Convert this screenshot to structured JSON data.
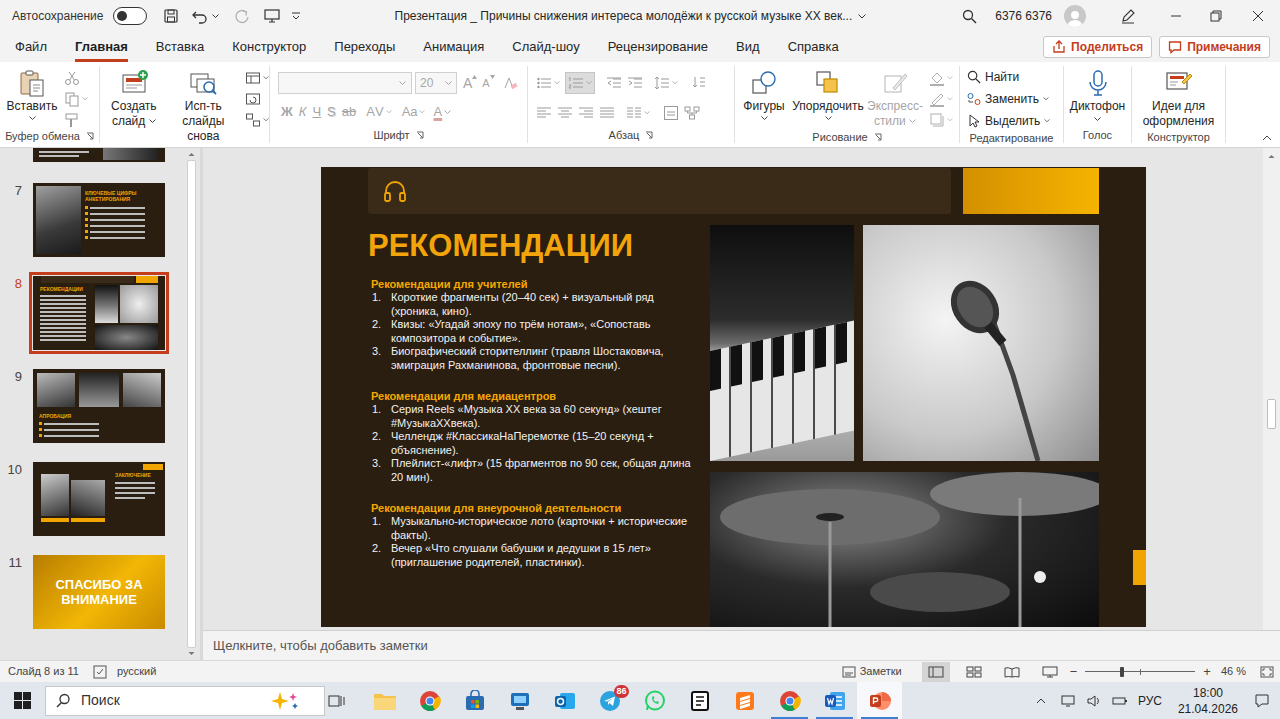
{
  "window": {
    "autosave": {
      "label": "Автосохранение",
      "on": false
    },
    "title": "Презентация _ Причины снижения интереса молодёжи к русской музыке XX век...",
    "user": "6376 6376"
  },
  "tabs": [
    {
      "label": "Файл",
      "selected": false
    },
    {
      "label": "Главная",
      "selected": true
    },
    {
      "label": "Вставка",
      "selected": false
    },
    {
      "label": "Конструктор",
      "selected": false
    },
    {
      "label": "Переходы",
      "selected": false
    },
    {
      "label": "Анимация",
      "selected": false
    },
    {
      "label": "Слайд-шоу",
      "selected": false
    },
    {
      "label": "Рецензирование",
      "selected": false
    },
    {
      "label": "Вид",
      "selected": false
    },
    {
      "label": "Справка",
      "selected": false
    }
  ],
  "share": {
    "label": "Поделиться"
  },
  "comments": {
    "label": "Примечания"
  },
  "ribbon": {
    "clipboard": {
      "label": "Буфер обмена",
      "paste": "Вставить"
    },
    "slides": {
      "label": "Слайды",
      "new_slide": "Создать слайд",
      "reuse": "Исп-ть слайды снова"
    },
    "font": {
      "label": "Шрифт",
      "disabled": true,
      "size": "20",
      "size_buttons": [
        "A",
        "A"
      ],
      "buttons": [
        {
          "label": "Ж",
          "kind": "bold"
        },
        {
          "label": "К",
          "kind": "italic"
        },
        {
          "label": "Ч",
          "kind": "underline"
        },
        {
          "label": "S",
          "kind": "shadow"
        },
        {
          "label": "ab",
          "kind": "strike"
        },
        {
          "label": "AV",
          "kind": "spacing"
        },
        {
          "label": "Aa",
          "kind": "case"
        }
      ],
      "color_button": "A"
    },
    "paragraph": {
      "label": "Абзац",
      "disabled": true,
      "numbering": true
    },
    "drawing": {
      "label": "Рисование",
      "shapes": "Фигуры",
      "arrange": "Упорядочить",
      "quick_styles": {
        "label": "Экспресс-стили",
        "disabled": true
      },
      "shape_format": {
        "disabled": true
      }
    },
    "editing": {
      "label": "Редактирование",
      "find": "Найти",
      "replace": "Заменить",
      "select": "Выделить"
    },
    "voice": {
      "label": "Голос",
      "dictate": "Диктофон"
    },
    "designer": {
      "label": "Конструктор",
      "ideas": "Идеи для оформления"
    }
  },
  "thumbnails": [
    {
      "number": "7",
      "kind": "stats",
      "title": "КЛЮЧЕВЫЕ ЦИФРЫ АНКЕТИРОВАНИЯ",
      "selected": false
    },
    {
      "number": "8",
      "kind": "recommend",
      "title": "РЕКОМЕНДАЦИИ",
      "selected": true
    },
    {
      "number": "9",
      "kind": "approbation",
      "title": "АПРОБАЦИЯ",
      "selected": false
    },
    {
      "number": "10",
      "kind": "conclusion",
      "title": "ЗАКЛЮЧЕНИЕ",
      "selected": false
    },
    {
      "number": "11",
      "kind": "thanks",
      "title": "СПАСИБО ЗА ВНИМАНИЕ",
      "selected": false
    }
  ],
  "slide": {
    "title": "РЕКОМЕНДАЦИИ",
    "sections": [
      {
        "heading": "Рекомендации для учителей",
        "items": [
          {
            "n": "1.",
            "text": "Короткие фрагменты (20–40 сек) + визуальный ряд (хроника, кино)."
          },
          {
            "n": "2.",
            "text": "Квизы: «Угадай эпоху по трём нотам», «Сопоставь композитора и событие»."
          },
          {
            "n": "3.",
            "text": "Биографический сторителлинг (травля Шостаковича, эмиграция Рахманинова, фронтовые песни)."
          }
        ]
      },
      {
        "heading": "Рекомендации для медиацентров",
        "items": [
          {
            "n": "1.",
            "text": "Серия Reels «Музыка XX века за 60 секунд» (хештег #МузыкаXXвека)."
          },
          {
            "n": "2.",
            "text": "Челлендж #КлассикаНаПеремотке (15–20 секунд + объяснение)."
          },
          {
            "n": "3.",
            "text": "Плейлист-«лифт» (15 фрагментов по 90 сек, общая длина 20 мин)."
          }
        ]
      },
      {
        "heading": "Рекомендации для внеурочной деятельности",
        "items": [
          {
            "n": "1.",
            "text": "Музыкально-историческое лото (карточки + исторические факты)."
          },
          {
            "n": "2.",
            "text": "Вечер «Что слушали бабушки и дедушки в 15 лет» (приглашение родителей, пластинки)."
          }
        ]
      }
    ]
  },
  "notes": {
    "placeholder": "Щелкните, чтобы добавить заметки"
  },
  "status_bar": {
    "slide": "Слайд 8 из 11",
    "language": "русский",
    "notes": "Заметки",
    "views": [
      {
        "selected": true
      },
      {
        "selected": false
      },
      {
        "selected": false
      },
      {
        "selected": false
      }
    ],
    "minus": "−",
    "plus": "+",
    "zoom_level": 0.33,
    "zoom": "46 %"
  },
  "taskbar": {
    "search": "Поиск",
    "telegram_badge": "86",
    "language": "РУС",
    "time": "18:00",
    "date": "21.04.2026",
    "apps": [
      {
        "running": false,
        "active": false
      },
      {
        "running": false,
        "active": false
      },
      {
        "running": false,
        "active": false
      },
      {
        "running": false,
        "active": false
      },
      {
        "running": false,
        "active": false
      },
      {
        "running": false,
        "active": false
      },
      {
        "running": false,
        "active": false
      },
      {
        "running": false,
        "active": false
      },
      {
        "running": false,
        "active": false
      },
      {
        "running": true,
        "active": false
      },
      {
        "running": true,
        "active": false
      },
      {
        "running": true,
        "active": true
      }
    ]
  }
}
